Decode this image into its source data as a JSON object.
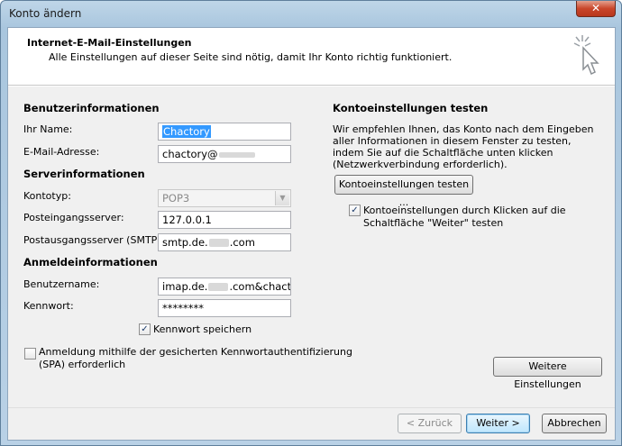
{
  "window": {
    "title": "Konto ändern",
    "close_glyph": "✕"
  },
  "header": {
    "title": "Internet-E-Mail-Einstellungen",
    "subtitle": "Alle Einstellungen auf dieser Seite sind nötig, damit Ihr Konto richtig funktioniert."
  },
  "user_info": {
    "heading": "Benutzerinformationen",
    "name_label": "Ihr Name:",
    "name_value": "Chactory",
    "email_label": "E-Mail-Adresse:",
    "email_value_prefix": "chactory@"
  },
  "server_info": {
    "heading": "Serverinformationen",
    "account_type_label": "Kontotyp:",
    "account_type_value": "POP3",
    "incoming_label": "Posteingangsserver:",
    "incoming_value": "127.0.0.1",
    "outgoing_label": "Postausgangsserver (SMTP):",
    "outgoing_value_prefix": "smtp.de.",
    "outgoing_value_suffix": ".com"
  },
  "login_info": {
    "heading": "Anmeldeinformationen",
    "username_label": "Benutzername:",
    "username_prefix": "imap.de.",
    "username_suffix": ".com&chactory",
    "password_label": "Kennwort:",
    "password_value": "********",
    "remember_password_label": "Kennwort speichern",
    "remember_password_checked": true,
    "spa_label_line1": "Anmeldung mithilfe der gesicherten Kennwortauthentifizierung",
    "spa_label_line2": "(SPA) erforderlich",
    "spa_checked": false
  },
  "test": {
    "heading": "Kontoeinstellungen testen",
    "description": "Wir empfehlen Ihnen, das Konto nach dem Eingeben aller Informationen in diesem Fenster zu testen, indem Sie auf die Schaltfläche unten klicken (Netzwerkverbindung erforderlich).",
    "test_button": "Kontoeinstellungen testen ...",
    "auto_test_line1": "Kontoeinstellungen durch Klicken auf die",
    "auto_test_line2": "Schaltfläche \"Weiter\" testen",
    "auto_test_checked": true,
    "more_settings_button": "Weitere Einstellungen"
  },
  "footer": {
    "back_button": "< Zurück",
    "next_button": "Weiter >",
    "cancel_button": "Abbrechen"
  },
  "icons": {
    "check": "✓",
    "dropdown": "▼",
    "header_icon": "cursor-click-icon"
  }
}
